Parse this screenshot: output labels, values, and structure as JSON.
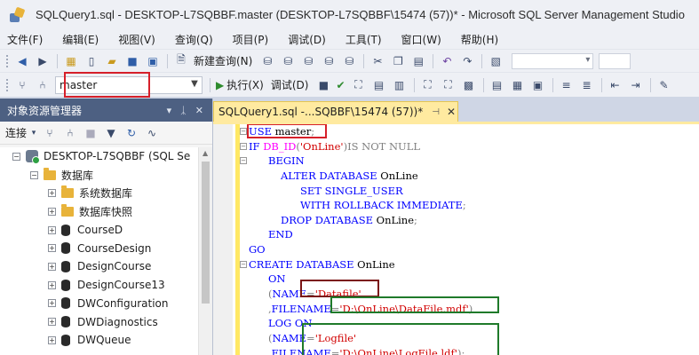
{
  "window": {
    "title": "SQLQuery1.sql - DESKTOP-L7SQBBF.master (DESKTOP-L7SQBBF\\15474 (57))* - Microsoft SQL Server Management Studio"
  },
  "menu": [
    "文件(F)",
    "编辑(E)",
    "视图(V)",
    "查询(Q)",
    "项目(P)",
    "调试(D)",
    "工具(T)",
    "窗口(W)",
    "帮助(H)"
  ],
  "toolbar1": {
    "new_query": "新建查询(N)"
  },
  "toolbar2": {
    "database": "master",
    "execute": "执行(X)",
    "debug": "调试(D)"
  },
  "object_explorer": {
    "title": "对象资源管理器",
    "connect": "连接",
    "server": "DESKTOP-L7SQBBF (SQL Se",
    "databases_folder": "数据库",
    "items": [
      {
        "label": "系统数据库",
        "icon": "folder-icon"
      },
      {
        "label": "数据库快照",
        "icon": "folder-icon"
      },
      {
        "label": "CourseD",
        "icon": "database-icon"
      },
      {
        "label": "CourseDesign",
        "icon": "database-icon"
      },
      {
        "label": "DesignCourse",
        "icon": "database-icon"
      },
      {
        "label": "DesignCourse13",
        "icon": "database-icon"
      },
      {
        "label": "DWConfiguration",
        "icon": "database-icon"
      },
      {
        "label": "DWDiagnostics",
        "icon": "database-icon"
      },
      {
        "label": "DWQueue",
        "icon": "database-icon"
      }
    ]
  },
  "editor": {
    "tab_title": "SQLQuery1.sql -...SQBBF\\15474 (57))*",
    "code": {
      "l1_kw": "USE",
      "l1_db": " master",
      "l1_end": ";",
      "l2_if": "IF ",
      "l2_fn": "DB_ID",
      "l2_lp": "(",
      "l2_str": "'OnLine'",
      "l2_rp": ")",
      "l2_rest": "IS NOT NULL",
      "l3": "BEGIN",
      "l4_kw": "ALTER DATABASE",
      "l4_name": " OnLine",
      "l5_kw": "SET SINGLE_USER",
      "l6_kw": "WITH ROLLBACK IMMEDIATE",
      "l6_end": ";",
      "l7_kw": "DROP DATABASE",
      "l7_name": " OnLine",
      "l7_end": ";",
      "l8": "END",
      "l9": "GO",
      "l10_kw": "CREATE DATABASE",
      "l10_name": " OnLine",
      "l11": "ON",
      "l12_lp": "(",
      "l12_name": "NAME",
      "l12_eq": "=",
      "l12_str": "'Datafile'",
      "l13_comma": ",",
      "l13_name": "FILENAME",
      "l13_eq": "=",
      "l13_str": "'D:\\OnLine\\DataFile.mdf'",
      "l13_rp": ")",
      "l14_kw": "LOG ON",
      "l15_lp": "(",
      "l15_name": "NAME",
      "l15_eq": "=",
      "l15_str": "'Logfile'",
      "l16_comma": ",",
      "l16_name": "FILENAME",
      "l16_eq": "=",
      "l16_str": "'D:\\OnLine\\LogFile.ldf'",
      "l16_rp": ")",
      "l16_end": ";"
    }
  },
  "colors": {
    "keyword": "#0000ff",
    "string": "#d10000",
    "function": "#ff00ff",
    "operator": "#808080",
    "highlight_red": "#d6202a",
    "highlight_green": "#1f7a2a",
    "tab_active": "#ffeaa0"
  }
}
